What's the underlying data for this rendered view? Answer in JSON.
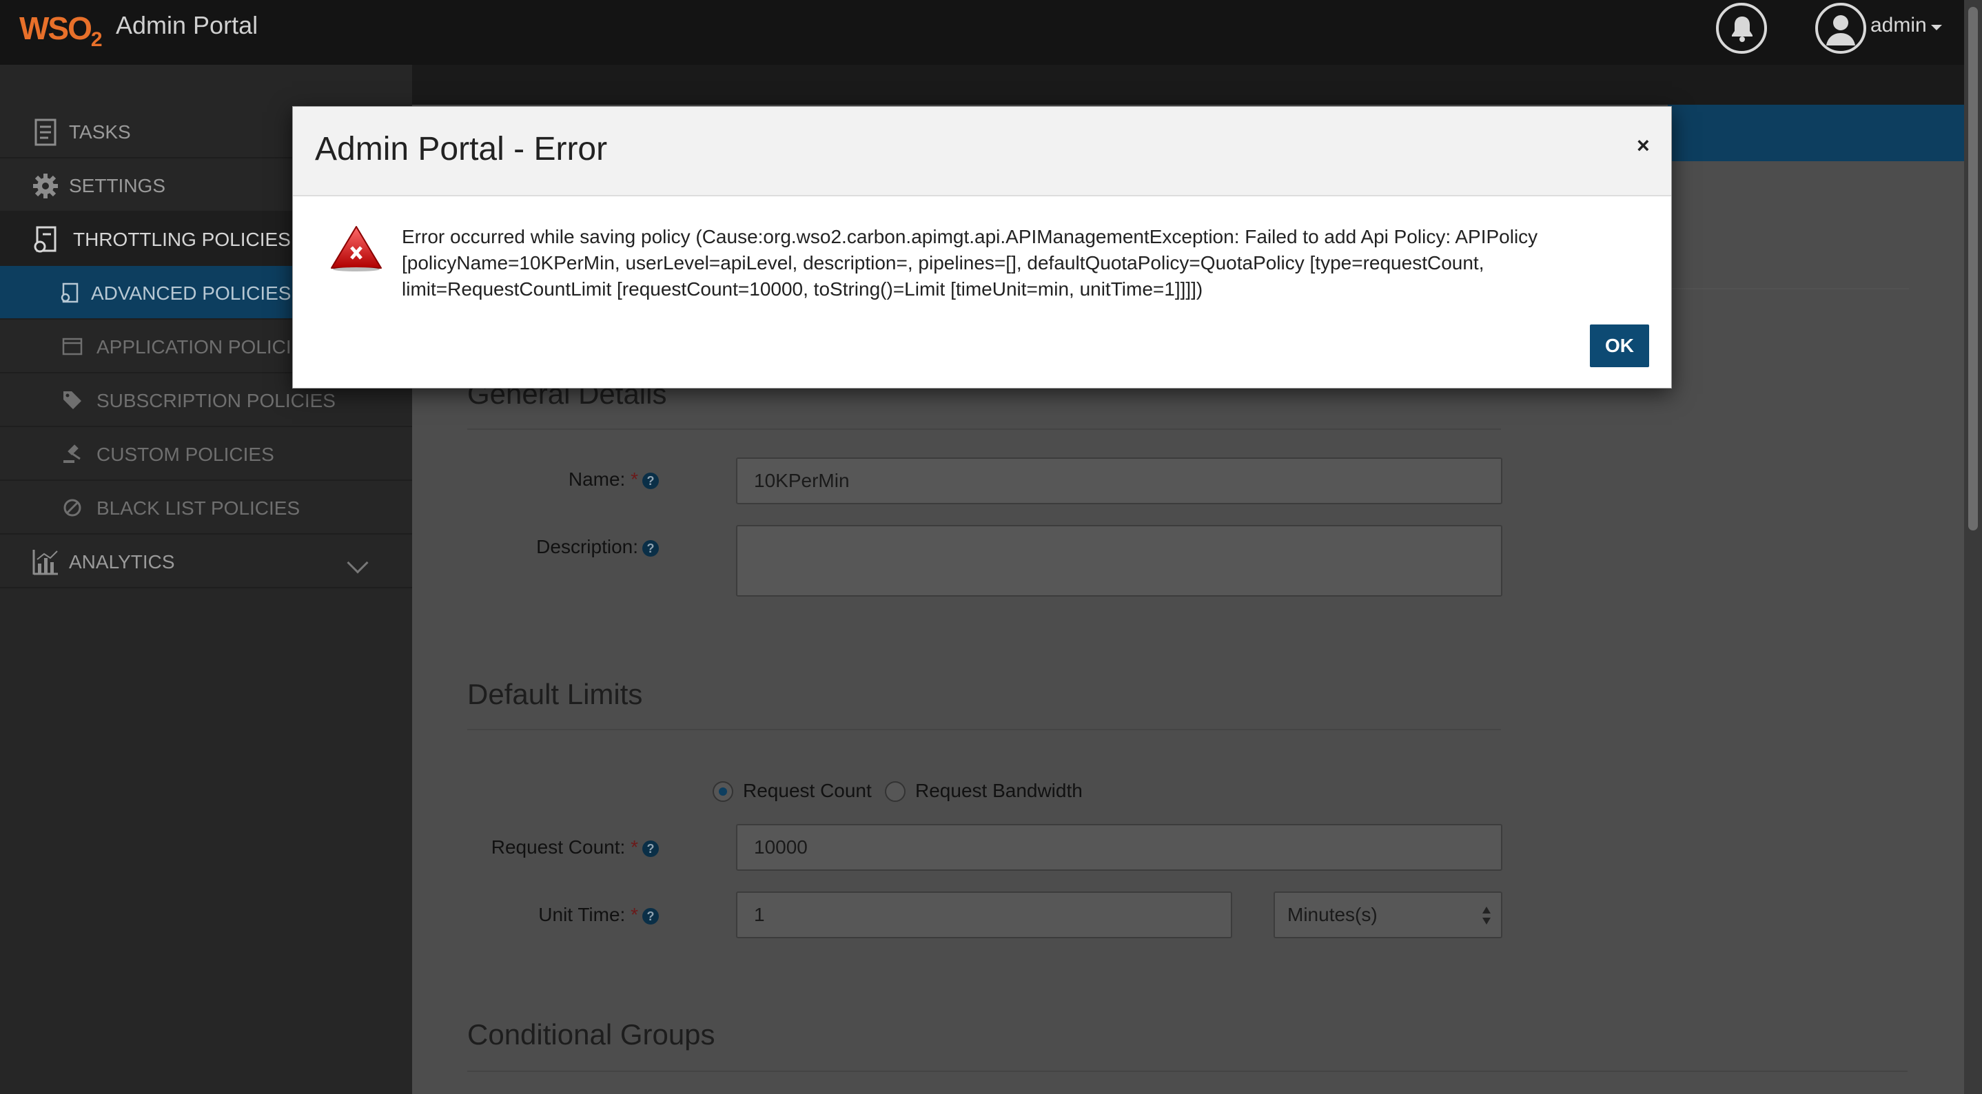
{
  "header": {
    "logo_text": "WSO",
    "logo_sub": "2",
    "app_title": "Admin Portal",
    "user_name": "admin"
  },
  "sidebar": {
    "items": [
      {
        "label": "TASKS",
        "icon": "tasks-icon"
      },
      {
        "label": "SETTINGS",
        "icon": "gear-icon"
      },
      {
        "label": "THROTTLING POLICIES",
        "icon": "policy-icon"
      },
      {
        "label": "ADVANCED POLICIES",
        "icon": "policy-doc-icon"
      },
      {
        "label": "APPLICATION POLICIE",
        "icon": "app-window-icon"
      },
      {
        "label": "SUBSCRIPTION POLICIES",
        "icon": "tag-icon"
      },
      {
        "label": "CUSTOM POLICIES",
        "icon": "gavel-icon"
      },
      {
        "label": "BLACK LIST POLICIES",
        "icon": "ban-icon"
      },
      {
        "label": "ANALYTICS",
        "icon": "chart-icon"
      }
    ]
  },
  "form": {
    "general_title": "General Details",
    "name_label": "Name:",
    "name_value": "10KPerMin",
    "description_label": "Description:",
    "description_value": "",
    "default_limits_title": "Default Limits",
    "radio_request_count": "Request Count",
    "radio_request_bandwidth": "Request Bandwidth",
    "request_count_label": "Request Count:",
    "request_count_value": "10000",
    "unit_time_label": "Unit Time:",
    "unit_time_value": "1",
    "unit_select_value": "Minutes(s)",
    "conditional_groups_title": "Conditional Groups",
    "required_mark": "*",
    "help_mark": "?"
  },
  "modal": {
    "title": "Admin Portal - Error",
    "close_label": "×",
    "message": "Error occurred while saving policy (Cause:org.wso2.carbon.apimgt.api.APIManagementException: Failed to add Api Policy: APIPolicy [policyName=10KPerMin, userLevel=apiLevel, description=, pipelines=[], defaultQuotaPolicy=QuotaPolicy [type=requestCount, limit=RequestCountLimit [requestCount=10000, toString()=Limit [timeUnit=min, unitTime=1]]]])",
    "ok_label": "OK"
  },
  "colors": {
    "accent": "#0d3e5f",
    "logo": "#e8702a",
    "ok_button": "#0d4a73"
  }
}
